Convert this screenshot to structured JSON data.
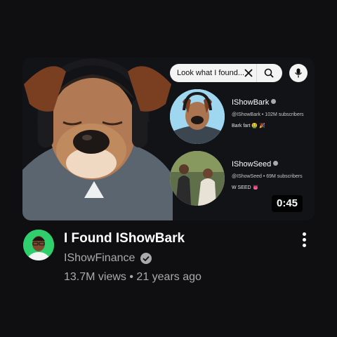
{
  "thumbnail": {
    "search_query": "Look what I found...",
    "duration": "0:45",
    "results": [
      {
        "channel": "IShowBark",
        "meta": "@IShowBark • 102M subscribers",
        "description": "Bark fart 🤮 🎉"
      },
      {
        "channel": "IShowSeed",
        "meta": "@IShowSeed • 69M subscribers",
        "description": "W SEED 👅"
      }
    ]
  },
  "video": {
    "title": "I Found IShowBark",
    "channel": "IShowFinance",
    "meta": "13.7M views • 21 years ago"
  },
  "icons": {
    "search": "search-icon",
    "clear": "close-icon",
    "mic": "mic-icon",
    "verified": "verified-check-icon",
    "more": "more-vertical-icon"
  },
  "colors": {
    "background": "#0f0f11",
    "thumbnail_bg": "#121317",
    "search_pill": "#f4f4f4",
    "secondary_text": "#aaaaaa",
    "avatar_bg": "#2fcf6e"
  }
}
